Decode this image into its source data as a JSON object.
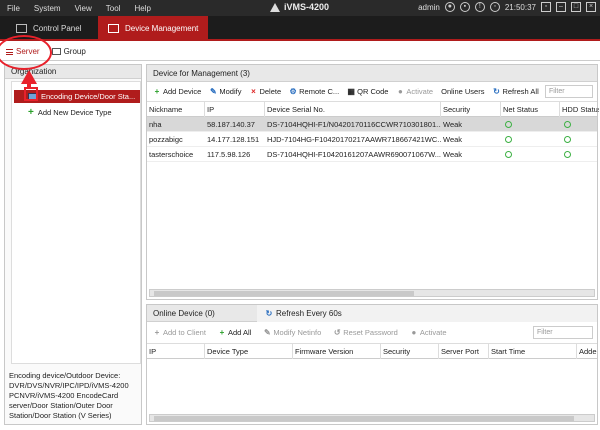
{
  "menubar": {
    "items": [
      "File",
      "System",
      "View",
      "Tool",
      "Help"
    ],
    "app_title": "iVMS-4200",
    "user": "admin",
    "time": "21:50:37"
  },
  "tabs": {
    "control_panel": "Control Panel",
    "device_management": "Device Management"
  },
  "subtabs": {
    "server": "Server",
    "group": "Group"
  },
  "organization": {
    "title": "Organization",
    "items": [
      "Encoding Device/Door Sta...",
      "Add New Device Type"
    ],
    "description": "Encoding device/Outdoor Device: DVR/DVS/NVR/IPC/IPD/iVMS-4200 PCNVR/iVMS-4200 EncodeCard server/Door Station/Outer Door Station/Door Station (V Series)"
  },
  "device_mgmt": {
    "title": "Device for Management (3)",
    "toolbar": {
      "add": "Add Device",
      "modify": "Modify",
      "delete": "Delete",
      "remote": "Remote C...",
      "qr": "QR Code",
      "activate": "Activate",
      "online_users": "Online Users",
      "refresh": "Refresh All",
      "filter_placeholder": "Filter"
    },
    "columns": [
      "Nickname",
      "IP",
      "Device Serial No.",
      "Security",
      "Net Status",
      "HDD Status"
    ],
    "rows": [
      {
        "nickname": "nha",
        "ip": "58.187.140.37",
        "serial": "DS-7104HQHI-F1/N0420170116CCWR710301801...",
        "security": "Weak"
      },
      {
        "nickname": "pozzabigc",
        "ip": "14.177.128.151",
        "serial": "HJD-7104HG-F10420170217AAWR718667421WC...",
        "security": "Weak"
      },
      {
        "nickname": "tasterschoice",
        "ip": "117.5.98.126",
        "serial": "DS-7104HQHI-F10420161207AAWR690071067W...",
        "security": "Weak"
      }
    ]
  },
  "online_device": {
    "title": "Online Device (0)",
    "refresh": "Refresh Every 60s",
    "toolbar": {
      "add_client": "Add to Client",
      "add_all": "Add All",
      "modify_netinfo": "Modify Netinfo",
      "reset_password": "Reset Password",
      "activate": "Activate",
      "filter_placeholder": "Filter"
    },
    "columns": [
      "IP",
      "Device Type",
      "Firmware Version",
      "Security",
      "Server Port",
      "Start Time",
      "Adde"
    ]
  }
}
